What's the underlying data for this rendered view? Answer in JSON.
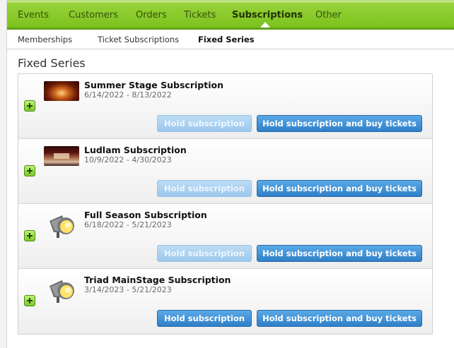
{
  "top_nav": {
    "items": [
      {
        "label": "Events",
        "active": false
      },
      {
        "label": "Customers",
        "active": false
      },
      {
        "label": "Orders",
        "active": false
      },
      {
        "label": "Tickets",
        "active": false
      },
      {
        "label": "Subscriptions",
        "active": true
      },
      {
        "label": "Other",
        "active": false
      }
    ]
  },
  "sub_nav": {
    "items": [
      {
        "label": "Memberships",
        "active": false
      },
      {
        "label": "Ticket Subscriptions",
        "active": false
      },
      {
        "label": "Fixed Series",
        "active": true
      }
    ]
  },
  "page": {
    "title": "Fixed Series"
  },
  "subscriptions": [
    {
      "name": "Summer Stage Subscription",
      "dates": "6/14/2022 - 8/13/2022",
      "image": "theater-photo",
      "hold_label": "Hold subscription",
      "hold_enabled": false,
      "hold_buy_label": "Hold subscription and buy tickets"
    },
    {
      "name": "Ludlam Subscription",
      "dates": "10/9/2022 - 4/30/2023",
      "image": "stage-photo",
      "hold_label": "Hold subscription",
      "hold_enabled": false,
      "hold_buy_label": "Hold subscription and buy tickets"
    },
    {
      "name": "Full Season Subscription",
      "dates": "6/18/2022 - 5/21/2023",
      "image": "spotlight-icon",
      "hold_label": "Hold subscription",
      "hold_enabled": false,
      "hold_buy_label": "Hold subscription and buy tickets"
    },
    {
      "name": "Triad MainStage Subscription",
      "dates": "3/14/2023 - 5/21/2023",
      "image": "spotlight-icon",
      "hold_label": "Hold subscription",
      "hold_enabled": true,
      "hold_buy_label": "Hold subscription and buy tickets"
    }
  ],
  "colors": {
    "nav_green": "#7cc21e",
    "button_blue": "#2f7fc8",
    "button_blue_disabled": "#9cc7ec"
  }
}
